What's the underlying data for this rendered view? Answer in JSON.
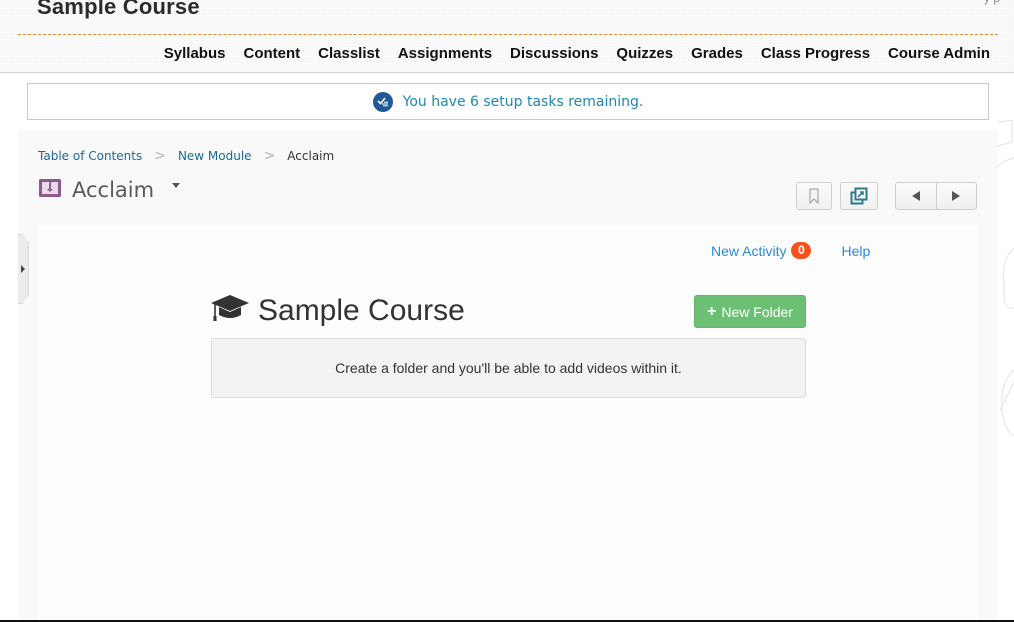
{
  "header": {
    "course_title": "Sample Course",
    "top_right_clip": "y          p",
    "nav": [
      {
        "label": "Syllabus"
      },
      {
        "label": "Content"
      },
      {
        "label": "Classlist"
      },
      {
        "label": "Assignments"
      },
      {
        "label": "Discussions"
      },
      {
        "label": "Quizzes"
      },
      {
        "label": "Grades"
      },
      {
        "label": "Class Progress"
      },
      {
        "label": "Course Admin"
      }
    ]
  },
  "setup_banner": {
    "icon": "checklist-icon",
    "text": "You have 6 setup tasks remaining."
  },
  "breadcrumbs": {
    "items": [
      {
        "label": "Table of Contents"
      },
      {
        "label": "New Module"
      }
    ],
    "separator": ">",
    "current": "Acclaim"
  },
  "topic": {
    "icon": "external-tool-icon",
    "title": "Acclaim",
    "menu_icon": "caret-down-icon"
  },
  "toolbar": {
    "bookmark_icon": "bookmark-icon",
    "popout_icon": "open-new-window-icon",
    "prev_icon": "previous-icon",
    "next_icon": "next-icon"
  },
  "acclaim": {
    "new_activity_label": "New Activity",
    "new_activity_count": "0",
    "help_label": "Help",
    "course_heading": "Sample Course",
    "new_folder_plus": "+",
    "new_folder_label": "New Folder",
    "empty_message": "Create a folder and you'll be able to add videos within it."
  },
  "colors": {
    "nav_divider": "#e68a2e",
    "banner_text": "#1c87b3",
    "link_blue": "#2a8ad8",
    "badge_orange": "#f4511e",
    "button_green": "#6cc073",
    "topic_icon_purple": "#8e5a8c"
  }
}
